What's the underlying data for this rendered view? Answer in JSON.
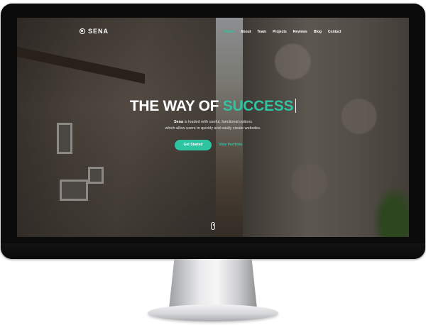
{
  "brand": {
    "name": "SENA",
    "icon": "ring-logo-icon"
  },
  "nav": {
    "items": [
      {
        "label": "Home",
        "active": true
      },
      {
        "label": "About",
        "active": false
      },
      {
        "label": "Team",
        "active": false
      },
      {
        "label": "Projects",
        "active": false
      },
      {
        "label": "Reviews",
        "active": false
      },
      {
        "label": "Blog",
        "active": false
      },
      {
        "label": "Contact",
        "active": false
      }
    ]
  },
  "hero": {
    "title_prefix": "THE WAY OF ",
    "title_accent": "SUCCESS",
    "subtitle_brand": "Sena",
    "subtitle_line1": " is loaded with useful, functional options",
    "subtitle_line2": "which allow users to quickly and easily create websites.",
    "primary_button": "Get Started",
    "secondary_link": "View Portfolio"
  },
  "colors": {
    "accent": "#2ec3a1",
    "text": "#ffffff",
    "bezel": "#0b0b0b"
  }
}
